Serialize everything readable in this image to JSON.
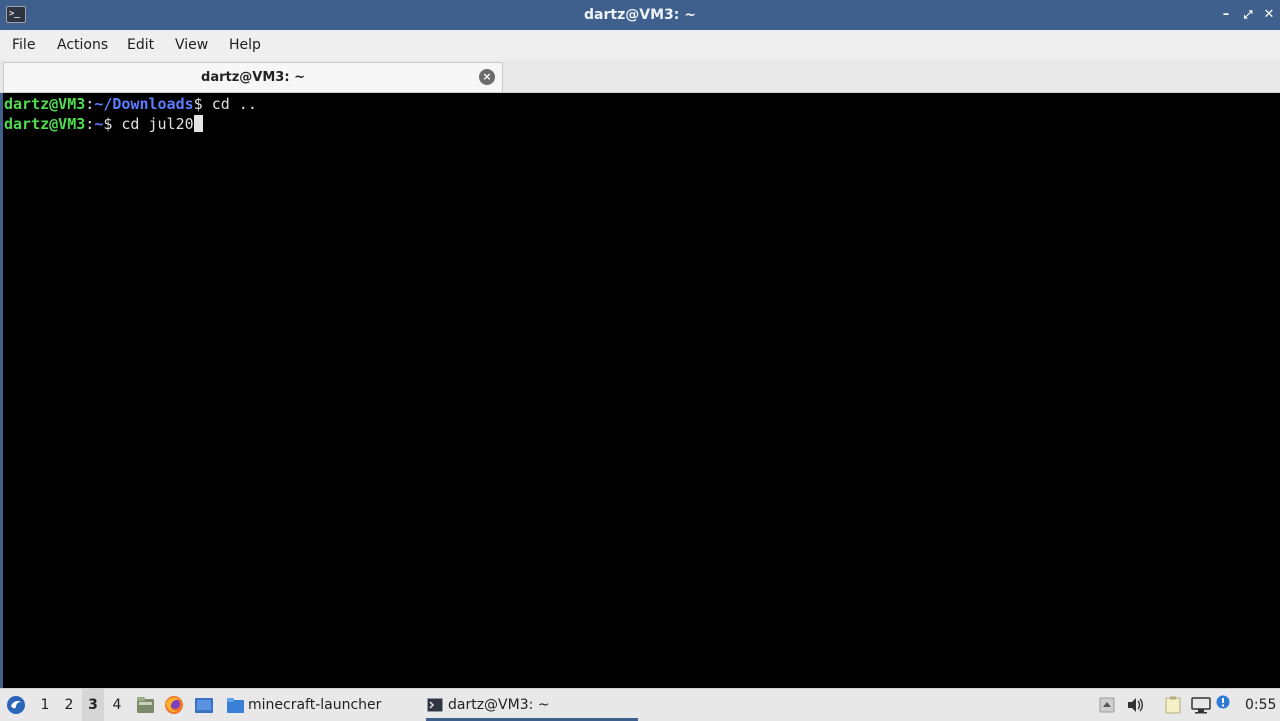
{
  "window": {
    "title": "dartz@VM3: ~",
    "buttons": {
      "minimize": "–",
      "maximize": "⤢",
      "close": "✕"
    }
  },
  "menu": {
    "items": [
      "File",
      "Actions",
      "Edit",
      "View",
      "Help"
    ]
  },
  "tab": {
    "title": "dartz@VM3: ~",
    "close": "×"
  },
  "terminal": {
    "lines": [
      {
        "user": "dartz@VM3",
        "sep": ":",
        "path": "~/Downloads",
        "prompt": "$ ",
        "command": "cd .."
      },
      {
        "user": "dartz@VM3",
        "sep": ":",
        "path": "~",
        "prompt": "$ ",
        "command": "cd jul20"
      }
    ],
    "colors": {
      "user": "#4fdc4f",
      "path": "#5b7dff",
      "background": "#000000"
    }
  },
  "taskbar": {
    "workspaces": [
      "1",
      "2",
      "3",
      "4"
    ],
    "active_workspace": "3",
    "tasks": [
      {
        "label": "minecraft-launcher",
        "icon": "folder-icon"
      },
      {
        "label": "dartz@VM3: ~",
        "icon": "terminal-icon"
      }
    ],
    "clock": "0:55"
  },
  "accent_color": "#3f5f8d"
}
